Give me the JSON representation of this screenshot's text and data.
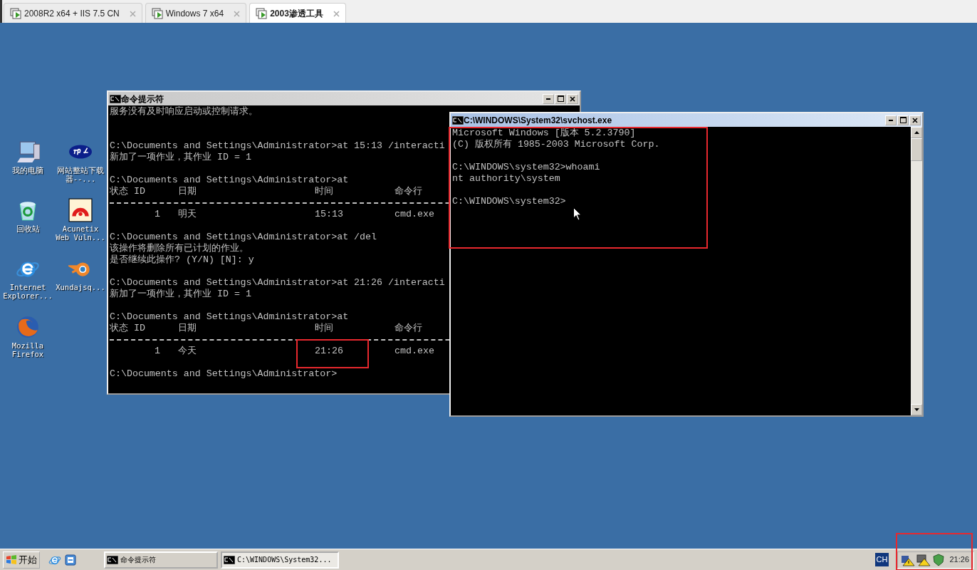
{
  "vm_tabs": [
    {
      "label": "2008R2 x64 + IIS 7.5 CN",
      "selected": false
    },
    {
      "label": "Windows 7 x64",
      "selected": false
    },
    {
      "label": "2003渗透工具",
      "selected": true
    }
  ],
  "desktop_icons": [
    {
      "kind": "computer",
      "label": "我的电脑"
    },
    {
      "kind": "tp",
      "label": "网站整站下载器--..."
    },
    {
      "kind": "recycle",
      "label": "回收站"
    },
    {
      "kind": "acunetix",
      "label": "Acunetix Web Vuln..."
    },
    {
      "kind": "ie",
      "label": "Internet Explorer..."
    },
    {
      "kind": "blender",
      "label": "Xundajsq..."
    },
    {
      "kind": "firefox",
      "label": "Mozilla Firefox"
    }
  ],
  "windows": [
    {
      "title": "命令提示符",
      "active": false,
      "highlighted": false,
      "lines": [
        {
          "kind": "text",
          "text": "服务没有及时响应启动或控制请求。"
        },
        {
          "kind": "blank"
        },
        {
          "kind": "blank"
        },
        {
          "kind": "text",
          "text": "C:\\Documents and Settings\\Administrator>at 15:13 /interacti"
        },
        {
          "kind": "text",
          "text": "新加了一项作业，其作业 ID = 1"
        },
        {
          "kind": "blank"
        },
        {
          "kind": "text",
          "text": "C:\\Documents and Settings\\Administrator>at"
        },
        {
          "kind": "table-header",
          "cells": [
            "状态 ID",
            "日期",
            "时间",
            "命令行"
          ]
        },
        {
          "kind": "rule"
        },
        {
          "kind": "table-row",
          "cells": [
            {
              "text": "1",
              "highlighted": false
            },
            {
              "text": "明天",
              "highlighted": false
            },
            {
              "text": "15:13",
              "highlighted": false
            },
            {
              "text": "cmd.exe",
              "highlighted": false
            }
          ]
        },
        {
          "kind": "blank"
        },
        {
          "kind": "text",
          "text": "C:\\Documents and Settings\\Administrator>at /del"
        },
        {
          "kind": "text",
          "text": "该操作将删除所有已计划的作业。"
        },
        {
          "kind": "text",
          "text": "是否继续此操作? (Y/N) [N]: y"
        },
        {
          "kind": "blank"
        },
        {
          "kind": "text",
          "text": "C:\\Documents and Settings\\Administrator>at 21:26 /interacti"
        },
        {
          "kind": "text",
          "text": "新加了一项作业，其作业 ID = 1"
        },
        {
          "kind": "blank"
        },
        {
          "kind": "text",
          "text": "C:\\Documents and Settings\\Administrator>at"
        },
        {
          "kind": "table-header",
          "cells": [
            "状态 ID",
            "日期",
            "时间",
            "命令行"
          ]
        },
        {
          "kind": "rule"
        },
        {
          "kind": "table-row",
          "cells": [
            {
              "text": "1",
              "highlighted": false
            },
            {
              "text": "今天",
              "highlighted": false
            },
            {
              "text": "21:26",
              "highlighted": true
            },
            {
              "text": "cmd.exe",
              "highlighted": false
            }
          ]
        },
        {
          "kind": "blank"
        },
        {
          "kind": "text",
          "text": "C:\\Documents and Settings\\Administrator>"
        }
      ]
    },
    {
      "title": "C:\\WINDOWS\\System32\\svchost.exe",
      "active": true,
      "highlighted": true,
      "scrollbar": true,
      "lines": [
        {
          "kind": "text",
          "text": "Microsoft Windows [版本 5.2.3790]"
        },
        {
          "kind": "text",
          "text": "(C) 版权所有 1985-2003 Microsoft Corp."
        },
        {
          "kind": "blank"
        },
        {
          "kind": "text",
          "text": "C:\\WINDOWS\\system32>whoami"
        },
        {
          "kind": "text",
          "text": "nt authority\\system"
        },
        {
          "kind": "blank"
        },
        {
          "kind": "text",
          "text": "C:\\WINDOWS\\system32>"
        }
      ]
    }
  ],
  "taskbar": {
    "start": "开始",
    "tasks": [
      {
        "label": "命令提示符",
        "selected": false
      },
      {
        "label": "C:\\WINDOWS\\System32...",
        "selected": true
      }
    ],
    "language": "CH",
    "clock": "21:26",
    "tray_highlighted": true
  }
}
